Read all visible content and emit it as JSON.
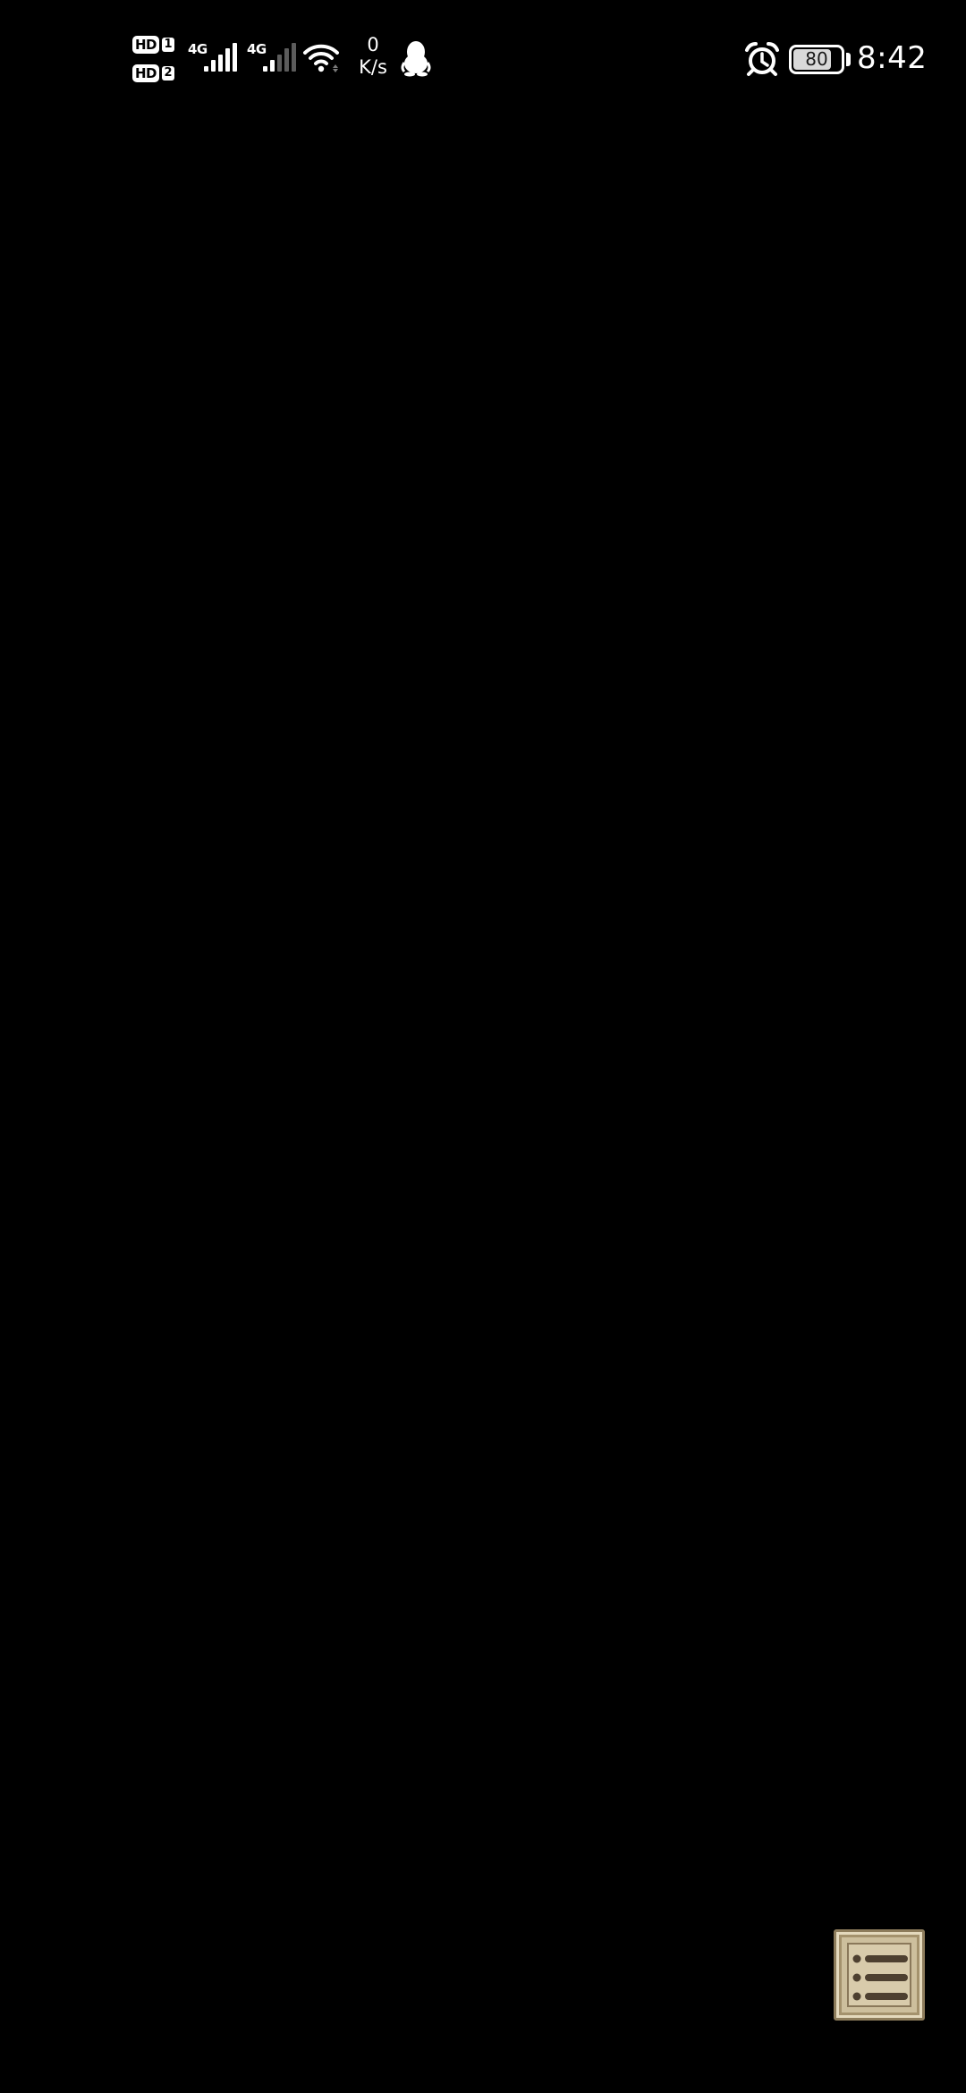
{
  "status_bar": {
    "sim1": {
      "badge": "HD",
      "slot": "1"
    },
    "sim2": {
      "badge": "HD",
      "slot": "2"
    },
    "network1": {
      "type": "4G",
      "signal_bars": 5,
      "signal_active": 5
    },
    "network2": {
      "type": "4G",
      "signal_bars": 5,
      "signal_active": 2
    },
    "wifi_icon": "wifi-icon",
    "speed_value": "0",
    "speed_unit": "K/s",
    "qq_icon": "penguin-icon",
    "alarm_icon": "alarm-clock-icon",
    "battery_level": "80",
    "time": "8:42"
  },
  "content": {
    "background": "#000000"
  },
  "menu_button": {
    "icon": "list-menu-icon",
    "color": "#cdbf9d"
  }
}
